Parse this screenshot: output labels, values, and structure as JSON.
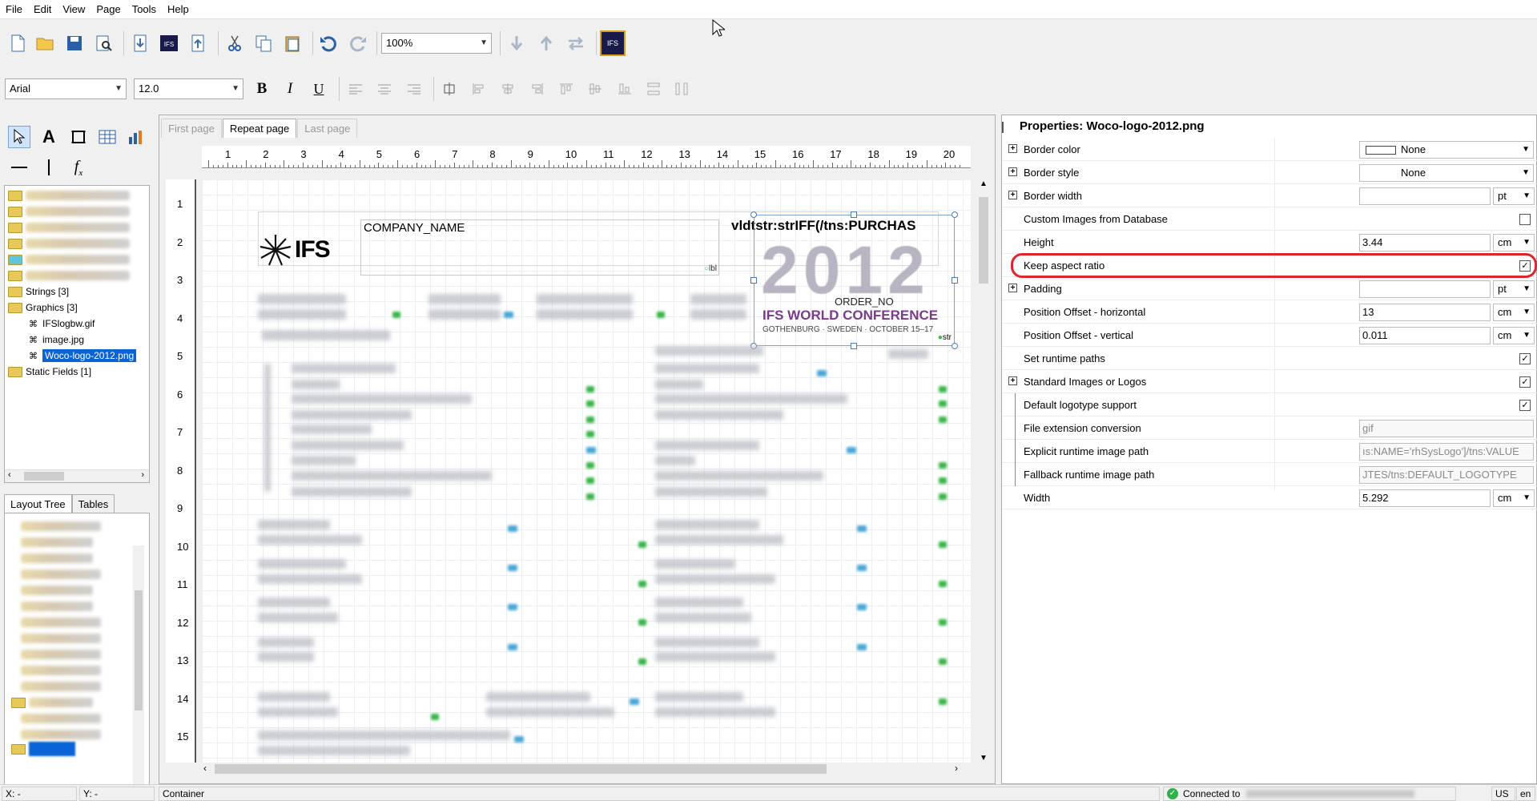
{
  "menu": [
    "File",
    "Edit",
    "View",
    "Page",
    "Tools",
    "Help"
  ],
  "toolbar": {
    "zoom": "100%",
    "font_name": "Arial",
    "font_size": "12.0",
    "bold": "B",
    "italic": "I",
    "underline": "U"
  },
  "tree": {
    "strings": "Strings [3]",
    "graphics": "Graphics [3]",
    "graphics_items": [
      "IFSlogbw.gif",
      "image.jpg",
      "Woco-logo-2012.png"
    ],
    "static_fields": "Static Fields [1]"
  },
  "left_tabs": [
    "Layout Tree",
    "Tables"
  ],
  "page_tabs": [
    "First page",
    "Repeat page",
    "Last page"
  ],
  "ruler": {
    "top": [
      "1",
      "2",
      "3",
      "4",
      "5",
      "6",
      "7",
      "8",
      "9",
      "10",
      "11",
      "12",
      "13",
      "14",
      "15",
      "16",
      "17",
      "18",
      "19",
      "20"
    ],
    "left": [
      "1",
      "2",
      "3",
      "4",
      "5",
      "6",
      "7",
      "8",
      "9",
      "10",
      "11",
      "12",
      "13",
      "14",
      "15"
    ]
  },
  "design": {
    "company_name": "COMPANY_NAME",
    "logo_text": "IFS",
    "vldtstr": "vldtstr:strIFF(/tns:PURCHAS",
    "conf_year": "2012",
    "conf_name": "IFS WORLD CONFERENCE",
    "conf_place": "GOTHENBURG · SWEDEN · OCTOBER 15–17",
    "order_no": "ORDER_NO",
    "lbl": "lbl",
    "str": "str"
  },
  "properties": {
    "title": "Properties: Woco-logo-2012.png",
    "rows": [
      {
        "label": "Border color",
        "value": "None"
      },
      {
        "label": "Border style",
        "value": "None"
      },
      {
        "label": "Border width",
        "value": "",
        "unit": "pt"
      },
      {
        "label": "Custom Images from Database",
        "checked": ""
      },
      {
        "label": "Height",
        "value": "3.44",
        "unit": "cm"
      },
      {
        "label": "Keep aspect ratio",
        "checked": "✓"
      },
      {
        "label": "Padding",
        "value": "",
        "unit": "pt"
      },
      {
        "label": "Position Offset - horizontal",
        "value": "13",
        "unit": "cm"
      },
      {
        "label": "Position Offset - vertical",
        "value": "0.011",
        "unit": "cm"
      },
      {
        "label": "Set runtime paths",
        "checked": "✓"
      },
      {
        "label": "Standard Images or Logos",
        "checked": "✓"
      },
      {
        "label": "Default logotype support",
        "checked": "✓"
      },
      {
        "label": "File extension conversion",
        "value": "gif"
      },
      {
        "label": "Explicit runtime image path",
        "value": "ıs:NAME='rhSysLogo']/tns:VALUE"
      },
      {
        "label": "Fallback runtime image path",
        "value": "JTES/tns:DEFAULT_LOGOTYPE"
      },
      {
        "label": "Width",
        "value": "5.292",
        "unit": "cm"
      }
    ]
  },
  "status": {
    "x": "X: -",
    "y": "Y: -",
    "container": "Container",
    "connected": "Connected to",
    "locale": "US",
    "lang": "en"
  },
  "colors": {
    "selection": "#0a64d6",
    "highlight_ring": "#e0242a",
    "connected_green": "#2fb24a"
  }
}
